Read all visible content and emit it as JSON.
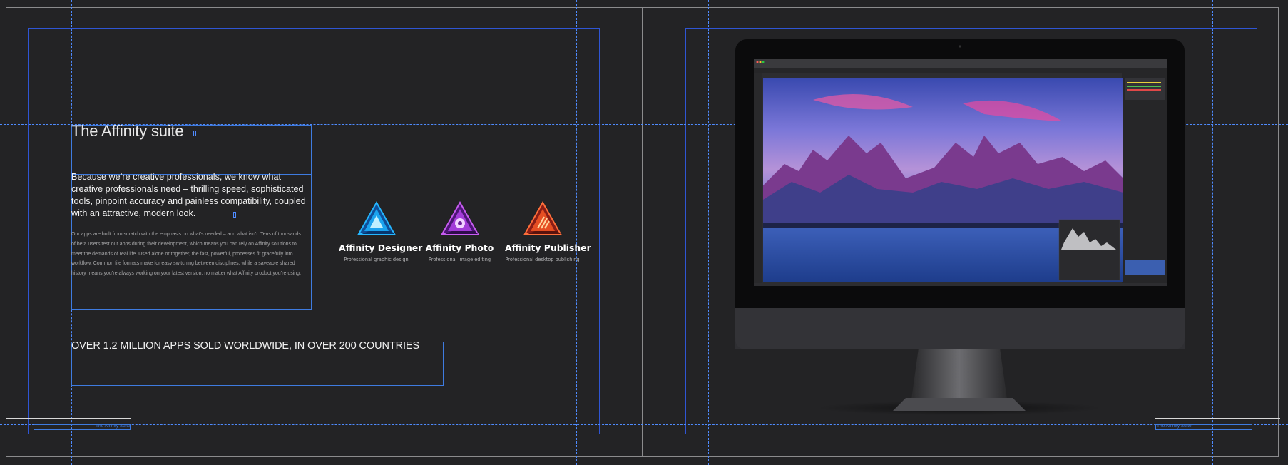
{
  "left_page": {
    "heading": "The Affinity suite",
    "lead": "Because we’re creative professionals, we know what creative professionals need – thrilling speed, sophisticated tools, pinpoint accuracy and painless compatibility, coupled with an attractive, modern look.",
    "body": "Our apps are built from scratch with the emphasis on what’s needed – and what isn’t.  Tens of thousands of beta users test our apps during their development, which means you can rely on Affinity solutions to meet the demands of real life. Used alone or together, the fast, powerful, processes fit gracefully into workflow.  Common file formats make for easy switching between disciplines, while a saveable shared history means you’re always working on your latest version, no matter what Affinity product you’re using.",
    "stat": "OVER 1.2 MILLION APPS SOLD WORLDWIDE, IN OVER 200 COUNTRIES",
    "apps": [
      {
        "name": "Affinity Designer",
        "desc": "Professional graphic design",
        "icon": "affinity-designer-icon",
        "color": "#1e9ee8"
      },
      {
        "name": "Affinity Photo",
        "desc": "Professional image editing",
        "icon": "affinity-photo-icon",
        "color": "#b13ee0"
      },
      {
        "name": "Affinity Publisher",
        "desc": "Professional desktop publishing",
        "icon": "affinity-publisher-icon",
        "color": "#ea5a2a"
      }
    ],
    "footer": "The Affinity Suite"
  },
  "right_page": {
    "footer": "The Affinity Suite"
  },
  "colors": {
    "pasteboard": "#232325",
    "margin_guide": "#2f55d4",
    "ruler_guide": "#4f8bff",
    "text_frame": "#3e7be0"
  }
}
